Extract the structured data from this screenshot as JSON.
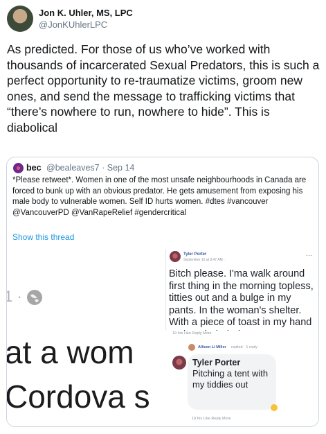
{
  "tweet": {
    "author_name": "Jon K. Uhler, MS, LPC",
    "author_handle": "@JonKUhlerLPC",
    "text": "As predicted. For those of us who’ve worked with thousands of incarcerated Sexual Predators, this is such a perfect opportunity to re-traumatize victims, groom new ones, and send the message to trafficking victims that “there’s nowhere to run, nowhere to hide”. This is diabolical"
  },
  "quote": {
    "author_name": "bec",
    "author_handle": "@bealeaves7 · Sep 14",
    "text": "*Please retweet*. Women in one of the most unsafe neighbourhoods in Canada are forced to bunk up with an obvious predator. He gets amusement from exposing his male body to vulnerable women. Self ID hurts women. #dtes #vancouver @VancouverPD @VanRapeRelief #gendercritical",
    "show_thread": "Show this thread"
  },
  "media": {
    "left_top_fragment": "1 · ",
    "left_text_line1": "at a wom",
    "left_text_line2": "Cordova s",
    "post": {
      "name": "Tyler Porter",
      "time": "September 10 at 9:47 AM · ",
      "more": "···",
      "body": "Bitch please. I'ma walk around first thing in the morning topless, titties out and a bulge in my pants. In the woman's shelter. With a piece of toast in my hand and my hair tied up",
      "meta": "19 hrs    Like    Reply    More"
    },
    "reply": {
      "name": "Allison Li Miller",
      "action": "replied · 1 reply"
    },
    "comment": {
      "name": "Tyler Porter",
      "body": "Pitching a tent with my tiddies out",
      "meta": "19 hrs    Like    Reply    More"
    }
  },
  "colors": {
    "link": "#1b95e0",
    "secondary_text": "#657786",
    "border": "#ccd6dd"
  }
}
